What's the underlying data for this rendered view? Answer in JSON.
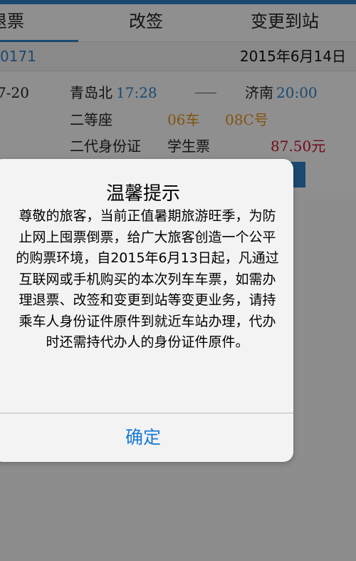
{
  "tabs": [
    {
      "label": "退票"
    },
    {
      "label": "改签"
    },
    {
      "label": "变更到站"
    }
  ],
  "order": {
    "number": "0171",
    "date": "2015年6月14日"
  },
  "ticket": {
    "date_fragment": "7-20",
    "from_station": "青岛北",
    "depart_time": "17:28",
    "arrow": "——",
    "to_station": "济南",
    "arrive_time": "20:00",
    "seat_class": "二等座",
    "car": "06车",
    "seat": "08C号",
    "id_type": "二代身份证",
    "ticket_type": "学生票",
    "price": "87.50元"
  },
  "dialog": {
    "title": "温馨提示",
    "message": "尊敬的旅客，当前正值暑期旅游旺季，为防止网上囤票倒票，给广大旅客创造一个公平的购票环境，自2015年6月13日起，凡通过互联网或手机购买的本次列车车票，如需办理退票、改签和变更到站等变更业务，请持乘车人身份证件原件到就近车站办理，代办时还需持代办人的身份证件原件。",
    "confirm_label": "确定"
  },
  "colors": {
    "accent": "#2f7fc2",
    "orange": "#e0901c",
    "price_red": "#c8102e",
    "dialog_button": "#1a7ad6"
  }
}
